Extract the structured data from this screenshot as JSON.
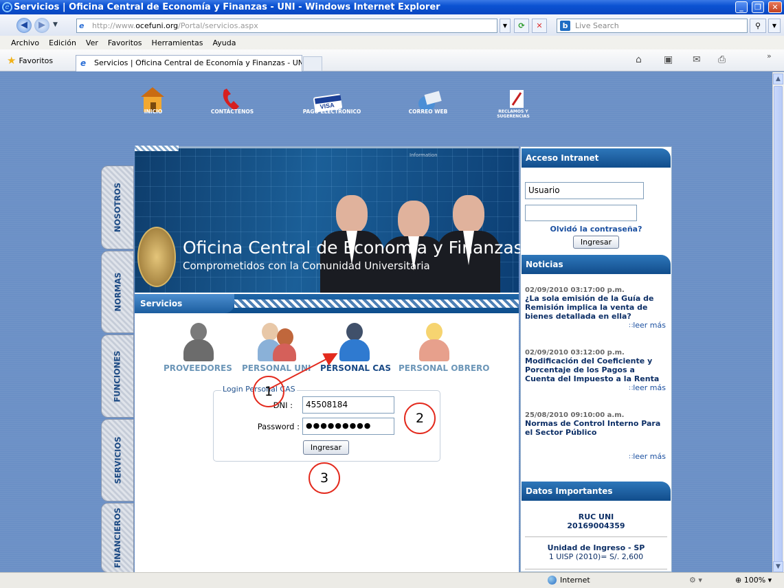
{
  "window": {
    "title": "Servicios | Oficina Central de Economía y Finanzas - UNI - Windows Internet Explorer"
  },
  "address_bar": {
    "url_prefix": "http://www.",
    "url_domain": "ocefuni.org",
    "url_path": "/Portal/servicios.aspx",
    "search_placeholder": "Live Search"
  },
  "menu": [
    "Archivo",
    "Edición",
    "Ver",
    "Favoritos",
    "Herramientas",
    "Ayuda"
  ],
  "favorites_bar": {
    "favorites_label": "Favoritos",
    "tab_title": "Servicios | Oficina Central de Economía y Finanzas - UNI"
  },
  "top_nav": [
    {
      "label": "INICIO",
      "icon": "home-icon"
    },
    {
      "label": "CONTÁCTENOS",
      "icon": "phone-icon"
    },
    {
      "label": "PAGO ELECTRONICO",
      "icon": "visa-card-icon"
    },
    {
      "label": "CORREO WEB",
      "icon": "mail-icon"
    },
    {
      "label": "RECLAMOS Y SUGERENCIAS",
      "icon": "pencil-icon"
    }
  ],
  "side_tabs": [
    "NOSOTROS",
    "NORMAS",
    "FUNCIONES",
    "SERVICIOS",
    "FINANCIEROS"
  ],
  "banner": {
    "title": "Oficina Central de Economía y Finanzas",
    "subtitle": "Comprometidos con la Comunidad Universitaria",
    "tag": "Information"
  },
  "services": {
    "header": "Servicios",
    "categories": [
      "PROVEEDORES",
      "PERSONAL UNI",
      "PERSONAL CAS",
      "PERSONAL OBRERO"
    ],
    "active_category": "PERSONAL CAS",
    "colors": {
      "inactive": "#6c96b8",
      "active": "#1a4a86"
    }
  },
  "login": {
    "legend": "Login Personal CAS",
    "dni_label": "DNI",
    "dni_value": "45508184",
    "password_label": "Password",
    "password_value": "●●●●●●●●●",
    "submit_label": "Ingresar"
  },
  "annotations": [
    "1",
    "2",
    "3"
  ],
  "intranet": {
    "header": "Acceso Intranet",
    "user_value": "Usuario",
    "password_value": "",
    "forgot_label": "Olvidó la contraseña?",
    "submit_label": "Ingresar"
  },
  "news": {
    "header": "Noticias",
    "more_label": "leer más",
    "items": [
      {
        "date": "02/09/2010 03:17:00 p.m.",
        "title": "¿La sola emisión de la Guía de Remisión implica la venta de bienes detallada en ella?"
      },
      {
        "date": "02/09/2010 03:12:00 p.m.",
        "title": "Modificación del Coeficiente y Porcentaje de los Pagos a Cuenta del Impuesto a la Renta"
      },
      {
        "date": "25/08/2010 09:10:00 a.m.",
        "title": "Normas de Control Interno Para el Sector Público"
      }
    ]
  },
  "datos": {
    "header": "Datos Importantes",
    "ruc_label": "RUC UNI",
    "ruc_value": "20169004359",
    "unidad_label": "Unidad de Ingreso - SP",
    "unidad_value": "1 UISP (2010)= S/. 2,600"
  },
  "status_bar": {
    "zone": "Internet",
    "zoom": "100%"
  }
}
